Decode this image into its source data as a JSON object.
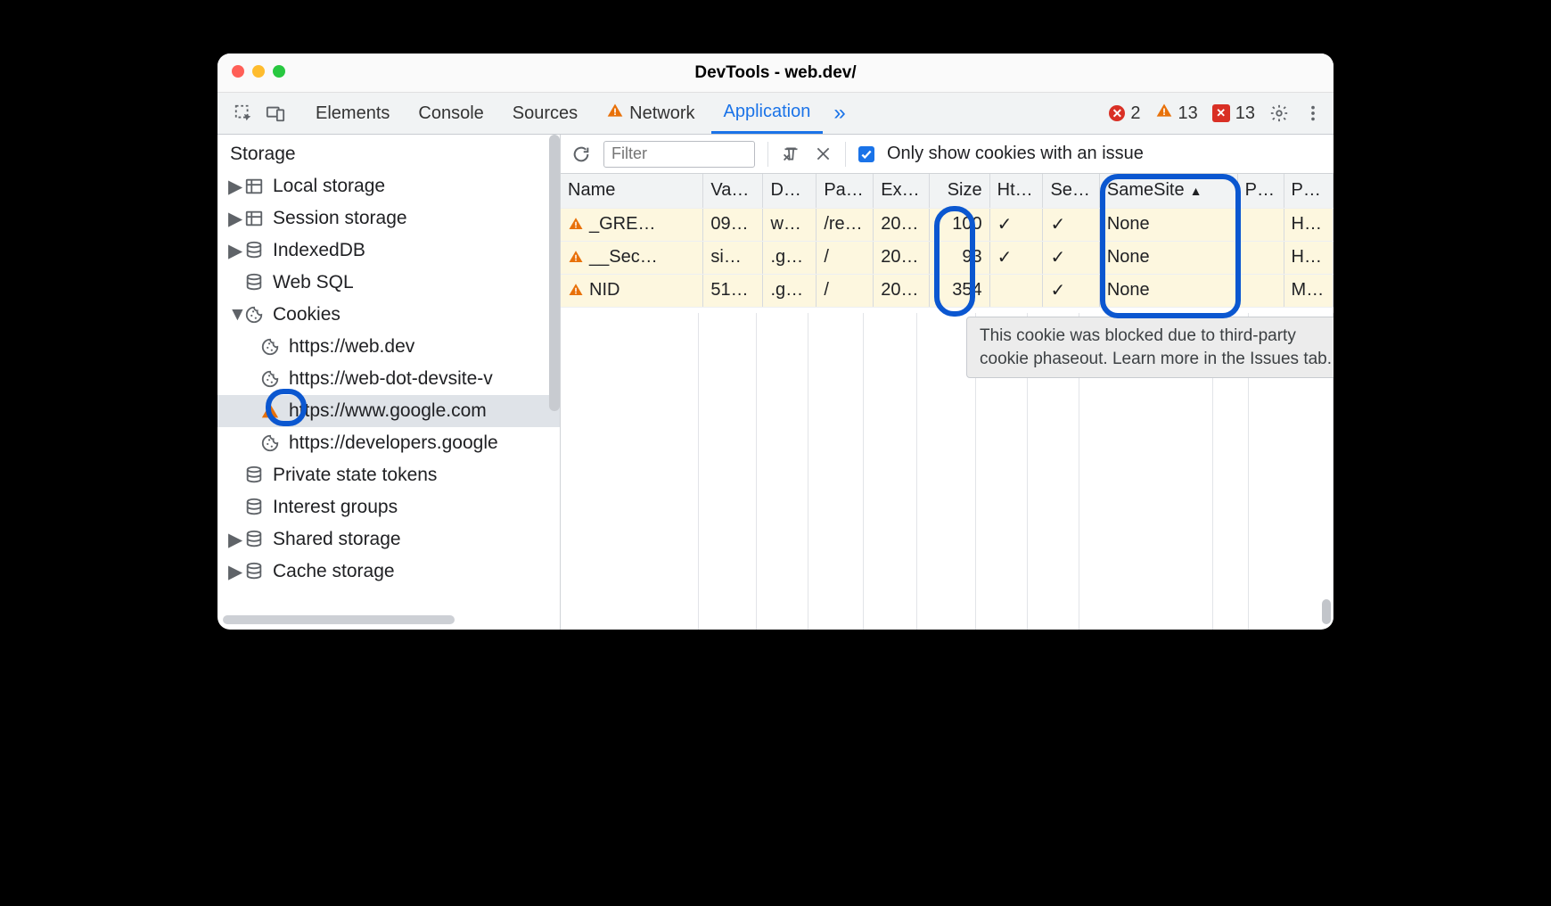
{
  "window": {
    "title": "DevTools - web.dev/"
  },
  "tabs": {
    "list": [
      "Elements",
      "Console",
      "Sources",
      "Network",
      "Application"
    ],
    "active": "Application",
    "network_has_warning": true
  },
  "status": {
    "errors": "2",
    "warnings": "13",
    "issues": "13"
  },
  "toolbar": {
    "filter_placeholder": "Filter",
    "only_issues_label": "Only show cookies with an issue",
    "only_issues_checked": true
  },
  "sidebar": {
    "section": "Storage",
    "items": [
      {
        "label": "Local storage",
        "icon": "table",
        "child": false,
        "expandable": true,
        "expanded": false
      },
      {
        "label": "Session storage",
        "icon": "table",
        "child": false,
        "expandable": true,
        "expanded": false
      },
      {
        "label": "IndexedDB",
        "icon": "db",
        "child": false,
        "expandable": true,
        "expanded": false
      },
      {
        "label": "Web SQL",
        "icon": "db",
        "child": false,
        "expandable": false
      },
      {
        "label": "Cookies",
        "icon": "cookie",
        "child": false,
        "expandable": true,
        "expanded": true
      },
      {
        "label": "https://web.dev",
        "icon": "cookie",
        "child": true
      },
      {
        "label": "https://web-dot-devsite-v",
        "icon": "cookie",
        "child": true
      },
      {
        "label": "https://www.google.com",
        "icon": "warn",
        "child": true,
        "selected": true
      },
      {
        "label": "https://developers.google",
        "icon": "cookie",
        "child": true
      },
      {
        "label": "Private state tokens",
        "icon": "db",
        "child": false,
        "expandable": false
      },
      {
        "label": "Interest groups",
        "icon": "db",
        "child": false,
        "expandable": false
      },
      {
        "label": "Shared storage",
        "icon": "db",
        "child": false,
        "expandable": true,
        "expanded": false
      },
      {
        "label": "Cache storage",
        "icon": "db",
        "child": false,
        "expandable": true,
        "expanded": false
      }
    ]
  },
  "table": {
    "columns": [
      "Name",
      "Va…",
      "D…",
      "Pa…",
      "Ex…",
      "Size",
      "Ht…",
      "Se…",
      "SameSite",
      "P…",
      "P…"
    ],
    "sort_column": "SameSite",
    "sort_dir": "asc",
    "rows": [
      {
        "warn": true,
        "name": "_GRE…",
        "value": "09…",
        "domain": "w…",
        "path": "/re…",
        "expires": "20…",
        "size": "100",
        "http": "✓",
        "secure": "✓",
        "samesite": "None",
        "p1": "",
        "p2": "H…"
      },
      {
        "warn": true,
        "name": "__Sec…",
        "value": "si…",
        "domain": ".g…",
        "path": "/",
        "expires": "20…",
        "size": "93",
        "http": "✓",
        "secure": "✓",
        "samesite": "None",
        "p1": "",
        "p2": "H…"
      },
      {
        "warn": true,
        "name": "NID",
        "value": "51…",
        "domain": ".g…",
        "path": "/",
        "expires": "20…",
        "size": "354",
        "http": "",
        "secure": "✓",
        "samesite": "None",
        "p1": "",
        "p2": "M…"
      }
    ]
  },
  "tooltip": {
    "text": "This cookie was blocked due to third-party cookie phaseout. Learn more in the Issues tab."
  }
}
